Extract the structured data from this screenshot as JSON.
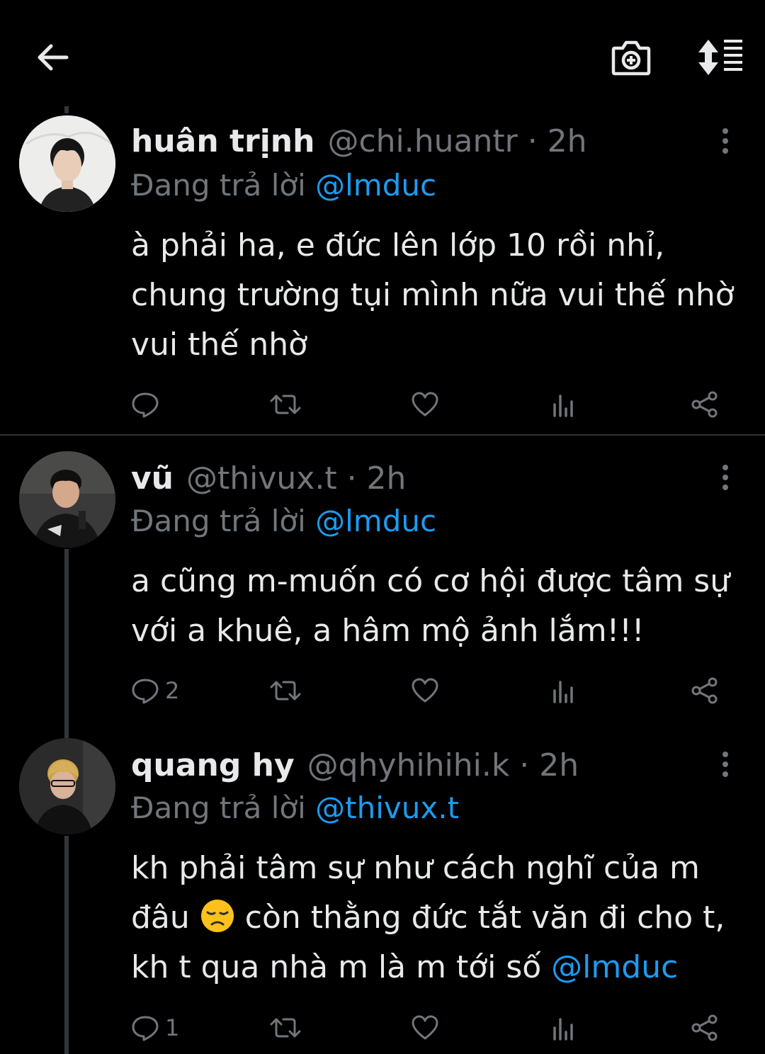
{
  "colors": {
    "background": "#000000",
    "text": "#e7e9ea",
    "muted": "#71767b",
    "accent": "#1d9bf0"
  },
  "topbar": {
    "back_icon": "back-arrow-icon",
    "camera_icon": "camera-plus-icon",
    "sort_icon": "sort-list-icon"
  },
  "tweets": [
    {
      "name": "huân trịnh",
      "handle": "@chi.huantr · 2h",
      "replying_prefix": "Đang trả lời",
      "replying_to": "@lmduc",
      "text": "à phải ha, e đức lên lớp 10 rồi nhỉ, chung trường tụi mình nữa vui thế nhờ vui thế nhờ",
      "reply_count": "",
      "icons": [
        "reply-icon",
        "retweet-icon",
        "like-icon",
        "views-icon",
        "share-icon"
      ]
    },
    {
      "name": "vũ",
      "handle": "@thivux.t · 2h",
      "replying_prefix": "Đang trả lời",
      "replying_to": "@lmduc",
      "text": "a cũng m-muốn có cơ hội được tâm sự với a khuê, a hâm mộ ảnh lắm!!!",
      "reply_count": "2",
      "icons": [
        "reply-icon",
        "retweet-icon",
        "like-icon",
        "views-icon",
        "share-icon"
      ]
    },
    {
      "name": "quang hy",
      "handle": "@qhyhihihi.k · 2h",
      "replying_prefix": "Đang trả lời",
      "replying_to": "@thivux.t",
      "text_part1": "kh phải tâm sự như cách nghĩ của m đâu",
      "text_emoji": "disappointed-face-emoji",
      "text_part2": " còn thằng đức tắt văn đi cho t, kh t qua nhà m là m tới số ",
      "text_mention": "@lmduc",
      "reply_count": "1",
      "icons": [
        "reply-icon",
        "retweet-icon",
        "like-icon",
        "views-icon",
        "share-icon"
      ]
    }
  ]
}
